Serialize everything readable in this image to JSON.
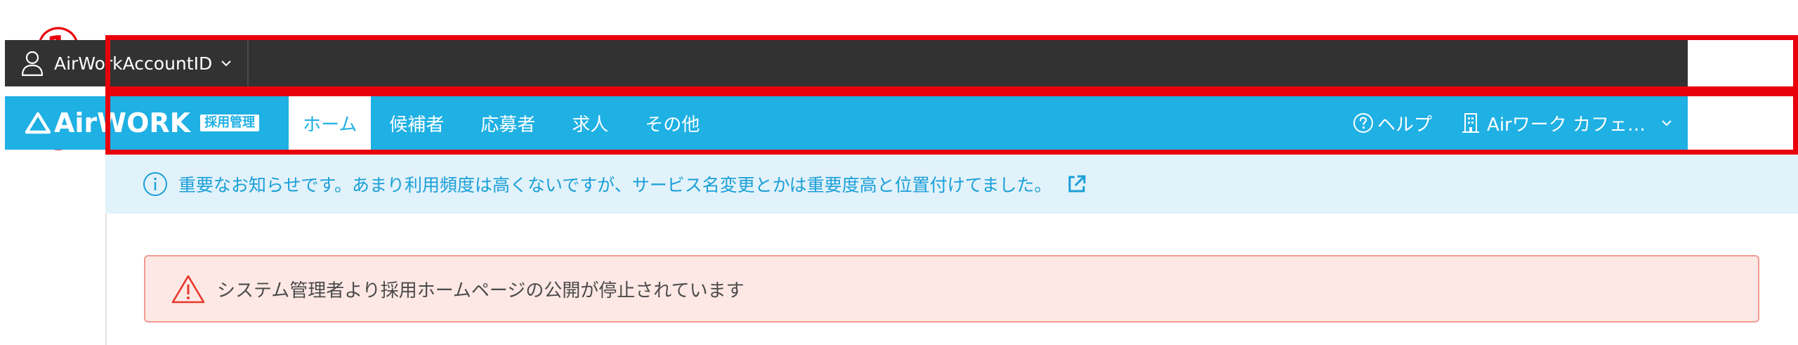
{
  "annotations": {
    "marker_1": "①",
    "marker_2": "②"
  },
  "account_bar": {
    "account_id": "AirWorkAccountID"
  },
  "nav": {
    "logo_text": "AirWORK",
    "logo_badge": "採用管理",
    "tabs": [
      {
        "label": "ホーム",
        "active": true
      },
      {
        "label": "候補者",
        "active": false
      },
      {
        "label": "応募者",
        "active": false
      },
      {
        "label": "求人",
        "active": false
      },
      {
        "label": "その他",
        "active": false
      }
    ],
    "help_label": "ヘルプ",
    "store_label": "Airワーク カフェ…"
  },
  "notice": {
    "text": "重要なお知らせです。あまり利用頻度は高くないですが、サービス名変更とかは重要度高と位置付けてました。"
  },
  "alert": {
    "text": "システム管理者より採用ホームページの公開が停止されています"
  },
  "colors": {
    "annotation_red": "#e8000b",
    "account_bar_bg": "#323232",
    "nav_bg": "#1fb0e4",
    "notice_bg": "#e2f2fa",
    "notice_text": "#1a9fd8",
    "alert_bg": "#fde8e5",
    "alert_border": "#f39a92"
  },
  "icons": {
    "account": "person-icon",
    "logo": "triangle-logo-icon",
    "help": "question-circle-icon",
    "store": "building-icon",
    "notice": "info-icon",
    "external": "external-link-icon",
    "alert": "warning-icon"
  }
}
